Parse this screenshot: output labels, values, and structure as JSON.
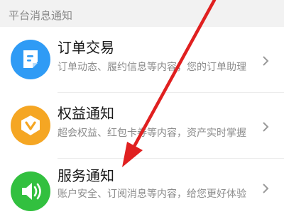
{
  "section_header": "平台消息通知",
  "items": [
    {
      "title": "订单交易",
      "description": "订单动态、履约信息等内容，您的订单助理",
      "icon": "document-icon",
      "icon_color": "#2f9bf5"
    },
    {
      "title": "权益通知",
      "description": "超会权益、红包卡券等内容，资产实时掌握",
      "icon": "v-shield-icon",
      "icon_color": "#f5a623"
    },
    {
      "title": "服务通知",
      "description": "账户安全、订阅消息等内容，给您更好体验",
      "icon": "speaker-icon",
      "icon_color": "#32c03f"
    }
  ],
  "annotation_color": "#e02020"
}
